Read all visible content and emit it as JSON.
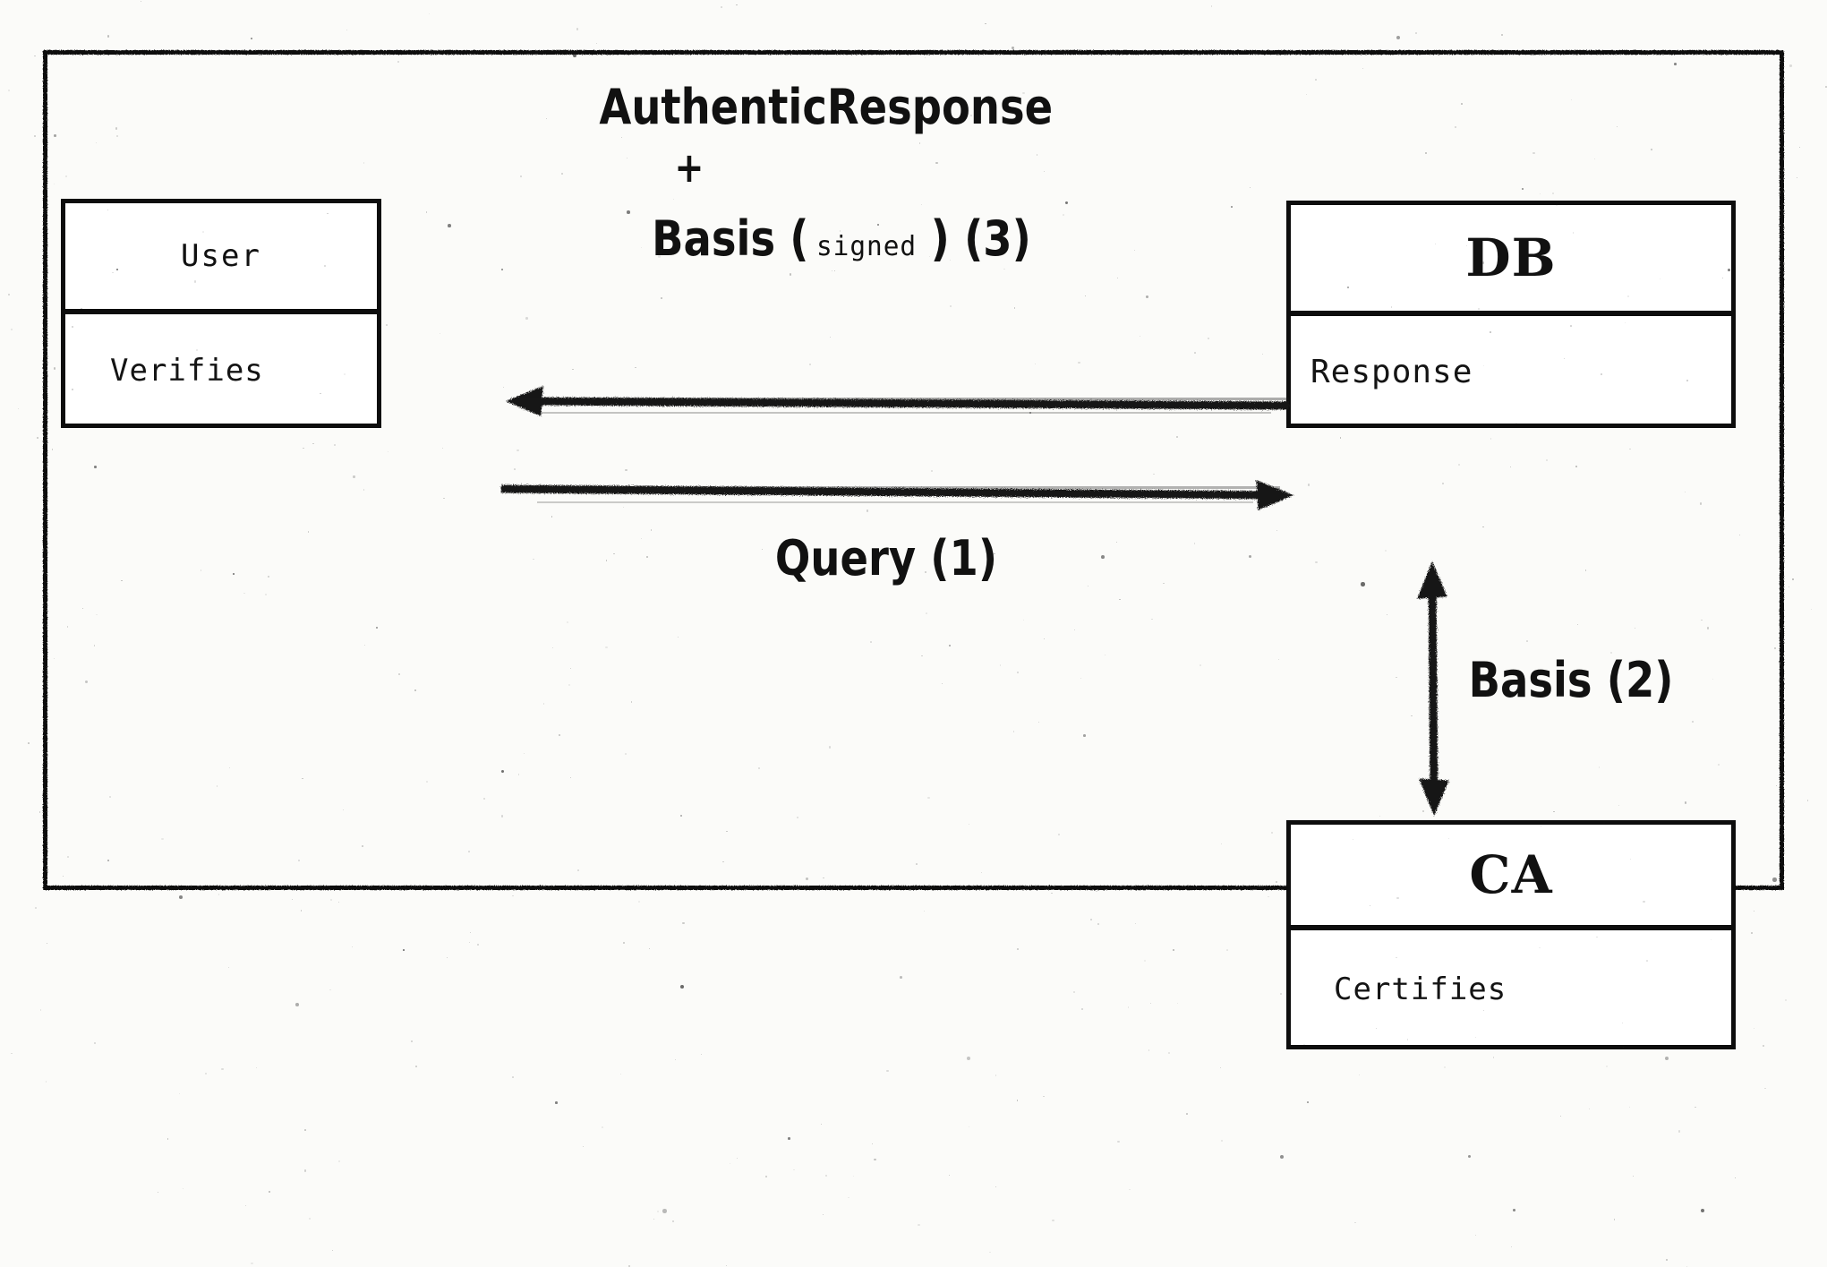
{
  "figure": {
    "type": "uml-collaboration-diagram",
    "title": "AuthenticResponse",
    "frame_present": true
  },
  "boxes": [
    {
      "id": "user",
      "name": "User",
      "operation": "Verifies",
      "position": "left"
    },
    {
      "id": "db",
      "name": "DB",
      "operation": "Response",
      "position": "top-right"
    },
    {
      "id": "ca",
      "name": "CA",
      "operation": "Certifies",
      "position": "bottom-right"
    }
  ],
  "labels": {
    "authentic_response": "AuthenticResponse",
    "plus": "+",
    "basis_open": "Basis (",
    "basis_signed": "signed",
    "basis_close": ") (3)",
    "query": "Query (1)",
    "basis2": "Basis (2)"
  },
  "messages": [
    {
      "sequence": "1",
      "label": "Query (1)",
      "from": "User",
      "to": "DB",
      "direction": "right"
    },
    {
      "sequence": "2",
      "label": "Basis (2)",
      "from": "CA",
      "to": "DB",
      "direction": "bidirectional-vertical"
    },
    {
      "sequence": "3",
      "label": "AuthenticResponse + Basis ( signed ) (3)",
      "from": "DB",
      "to": "User",
      "direction": "left"
    }
  ],
  "colors": {
    "ink": "#111111",
    "paper": "#fbfbf9"
  }
}
